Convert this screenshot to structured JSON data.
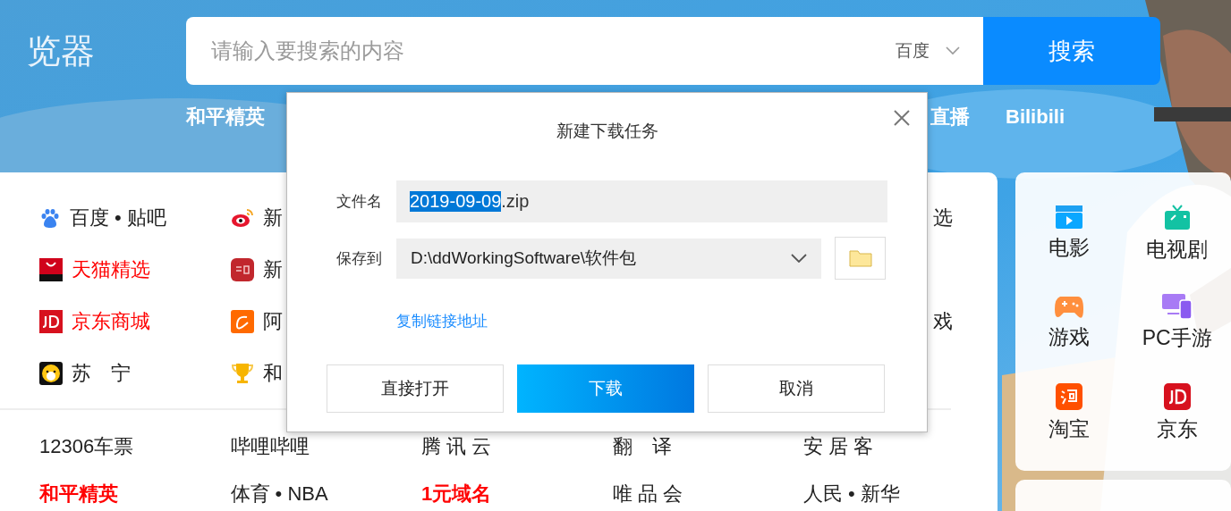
{
  "logo": {
    "text": "览器"
  },
  "search": {
    "placeholder": "请输入要搜索的内容",
    "engine": "百度",
    "button": "搜索"
  },
  "nav": [
    {
      "label": "和平精英"
    },
    {
      "label": "直播"
    },
    {
      "label": "Bilibili"
    }
  ],
  "site_columns": [
    {
      "items": [
        {
          "text": "百度 • 贴吧",
          "kind": "plain"
        },
        {
          "text": "天猫精选",
          "kind": "red"
        },
        {
          "text": "京东商城",
          "kind": "red"
        },
        {
          "text": "苏　宁",
          "kind": "plain"
        }
      ]
    },
    {
      "items": [
        {
          "text": "新",
          "kind": "plain"
        },
        {
          "text": "新",
          "kind": "plain"
        },
        {
          "text": "阿",
          "kind": "plain"
        },
        {
          "text": "和",
          "kind": "plain"
        }
      ]
    },
    {
      "items": [
        {
          "text": "选",
          "kind": "plain"
        },
        {
          "kind": "none"
        },
        {
          "text": "戏",
          "kind": "plain"
        },
        {
          "kind": "none"
        }
      ]
    }
  ],
  "text_links": [
    [
      {
        "text": "12306车票",
        "kind": "plain"
      },
      {
        "text": "哔哩哔哩",
        "kind": "plain"
      },
      {
        "text": "腾 讯 云",
        "kind": "plain"
      },
      {
        "text": "翻　译",
        "kind": "plain"
      },
      {
        "text": "安 居 客",
        "kind": "plain"
      }
    ],
    [
      {
        "text": "和平精英",
        "kind": "red-bold"
      },
      {
        "text": "体育 • NBA",
        "kind": "plain"
      },
      {
        "text": "1元域名",
        "kind": "red-bold"
      },
      {
        "text": "唯 品 会",
        "kind": "plain"
      },
      {
        "text": "人民 • 新华",
        "kind": "plain"
      }
    ]
  ],
  "quick_links": [
    {
      "label": "电影"
    },
    {
      "label": "电视剧"
    },
    {
      "label": "游戏"
    },
    {
      "label": "PC手游"
    },
    {
      "label": "淘宝"
    },
    {
      "label": "京东"
    }
  ],
  "dialog": {
    "title": "新建下载任务",
    "filename_label": "文件名",
    "filename_selected": "2019-09-09",
    "filename_rest": ".zip",
    "save_label": "保存到",
    "save_path": "D:\\ddWorkingSoftware\\软件包",
    "copy_link": "复制链接地址",
    "buttons": [
      {
        "label": "直接打开",
        "kind": "default"
      },
      {
        "label": "下载",
        "kind": "primary"
      },
      {
        "label": "取消",
        "kind": "default"
      }
    ]
  }
}
